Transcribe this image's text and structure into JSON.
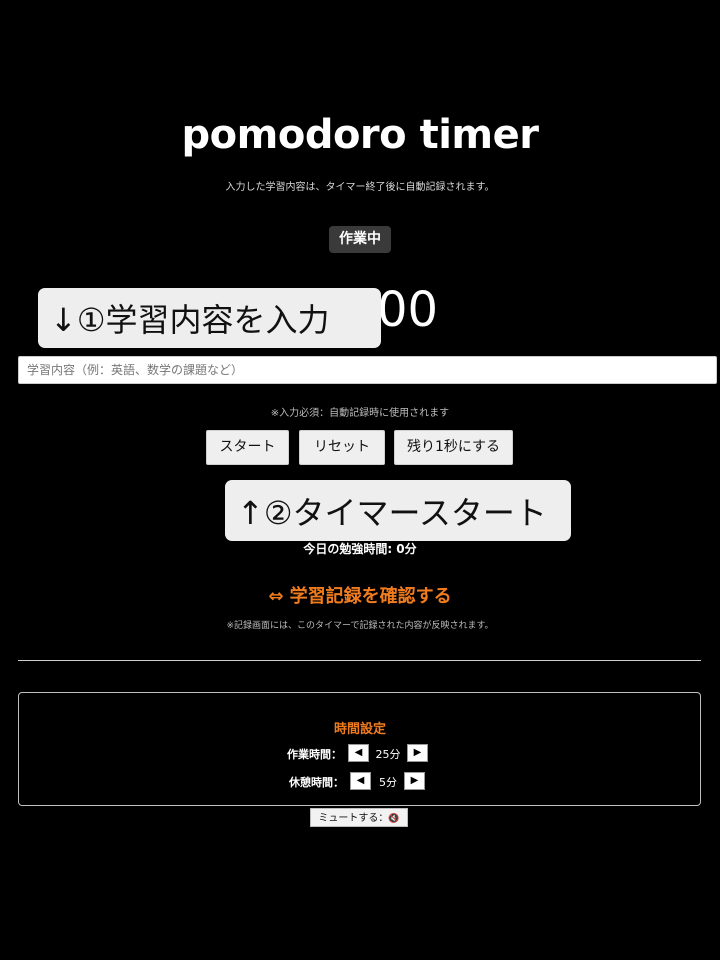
{
  "header": {
    "title": "pomodoro timer",
    "subtitle": "入力した学習内容は、タイマー終了後に自動記録されます。"
  },
  "status": {
    "label": "作業中"
  },
  "timer": {
    "visible_fragment": "00"
  },
  "callouts": {
    "first": "↓①学習内容を入力",
    "second": "↑②タイマースタート"
  },
  "study_input": {
    "value": "",
    "placeholder": "学習内容（例：英語、数学の課題など）"
  },
  "required_note": "※入力必須：自動記録時に使用されます",
  "controls": {
    "start_label": "スタート",
    "reset_label": "リセット",
    "last_second_label": "残り1秒にする"
  },
  "today": {
    "label": "今日の勉強時間: 0分"
  },
  "records": {
    "link_label": "⇔ 学習記録を確認する",
    "note": "※記録画面には、このタイマーで記録された内容が反映されます。"
  },
  "settings": {
    "title": "時間設定",
    "work": {
      "label": "作業時間：",
      "value": "25分",
      "dec": "◀",
      "inc": "▶"
    },
    "break": {
      "label": "休憩時間：",
      "value": "5分",
      "dec": "◀",
      "inc": "▶"
    }
  },
  "mute": {
    "label": "ミュートする：",
    "icon": "speaker-icon",
    "glyph": "🔇"
  },
  "colors": {
    "background": "#000000",
    "accent_orange": "#f07c1e",
    "button_bg": "#efefef",
    "badge_bg": "#3a3a3a"
  }
}
